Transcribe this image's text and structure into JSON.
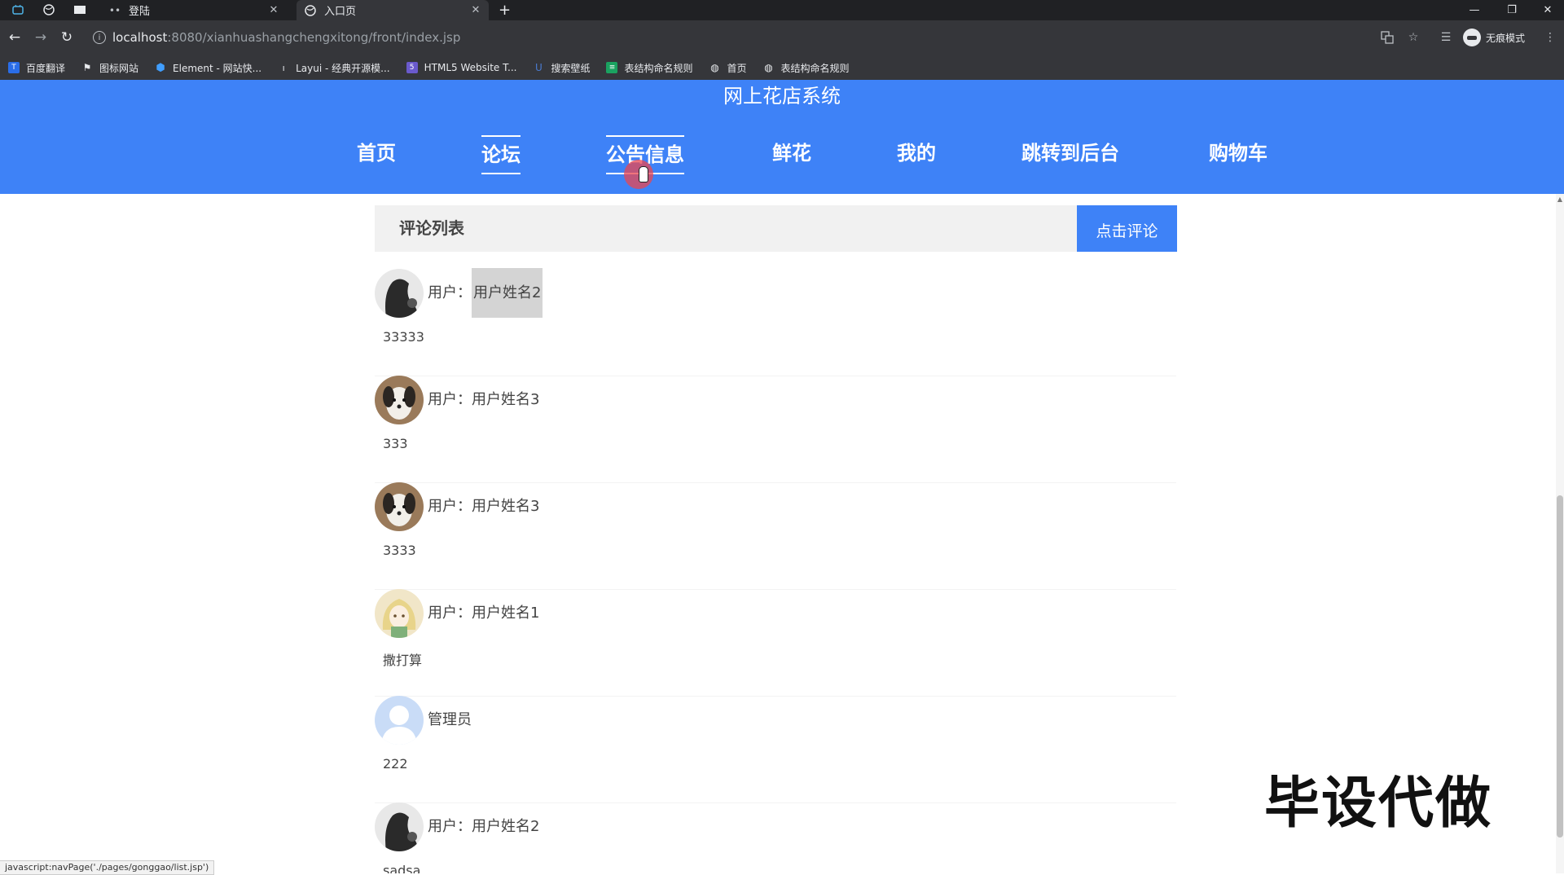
{
  "browser": {
    "tabs": [
      {
        "label": "登陆"
      },
      {
        "label": "入口页"
      }
    ],
    "url_host": "localhost",
    "url_rest": ":8080/xianhuashangchengxitong/front/index.jsp",
    "incognito_label": "无痕模式",
    "bookmarks": [
      {
        "label": "百度翻译",
        "icon": "baidu-translate-icon",
        "color": "#2a6de8"
      },
      {
        "label": "图标网站",
        "icon": "flag-icon",
        "color": "#555555"
      },
      {
        "label": "Element - 网站快...",
        "icon": "element-icon",
        "color": "#409eff"
      },
      {
        "label": "Layui - 经典开源模...",
        "icon": "layui-icon",
        "color": "#5a5a5a"
      },
      {
        "label": "HTML5 Website T...",
        "icon": "html5-icon",
        "color": "#6a5acd"
      },
      {
        "label": "搜索壁纸",
        "icon": "wallpaper-icon",
        "color": "#4a7bd0"
      },
      {
        "label": "表结构命名规则",
        "icon": "sheet-icon",
        "color": "#1aa260"
      },
      {
        "label": "首页",
        "icon": "globe-icon",
        "color": "#666666"
      },
      {
        "label": "表结构命名规则",
        "icon": "globe-icon",
        "color": "#666666"
      }
    ],
    "status_text": "javascript:navPage('./pages/gonggao/list.jsp')"
  },
  "site": {
    "title": "网上花店系统",
    "nav": [
      {
        "label": "首页"
      },
      {
        "label": "论坛"
      },
      {
        "label": "公告信息"
      },
      {
        "label": "鲜花"
      },
      {
        "label": "我的"
      },
      {
        "label": "跳转到后台"
      },
      {
        "label": "购物车"
      }
    ],
    "accent": "#3e82f7"
  },
  "comments": {
    "header": "评论列表",
    "button": "点击评论",
    "prefix": "用户：",
    "items": [
      {
        "user": "用户姓名2",
        "text": "33333",
        "avatar": "dark-figure"
      },
      {
        "user": "用户姓名3",
        "text": "333",
        "avatar": "dog"
      },
      {
        "user": "用户姓名3",
        "text": "3333",
        "avatar": "dog"
      },
      {
        "user": "用户姓名1",
        "text": "撒打算",
        "avatar": "anime-girl"
      },
      {
        "user": "管理员",
        "text": "222",
        "avatar": "default-person"
      },
      {
        "user": "用户姓名2",
        "text": "sadsa",
        "avatar": "dark-figure"
      }
    ]
  },
  "watermark": "毕设代做"
}
